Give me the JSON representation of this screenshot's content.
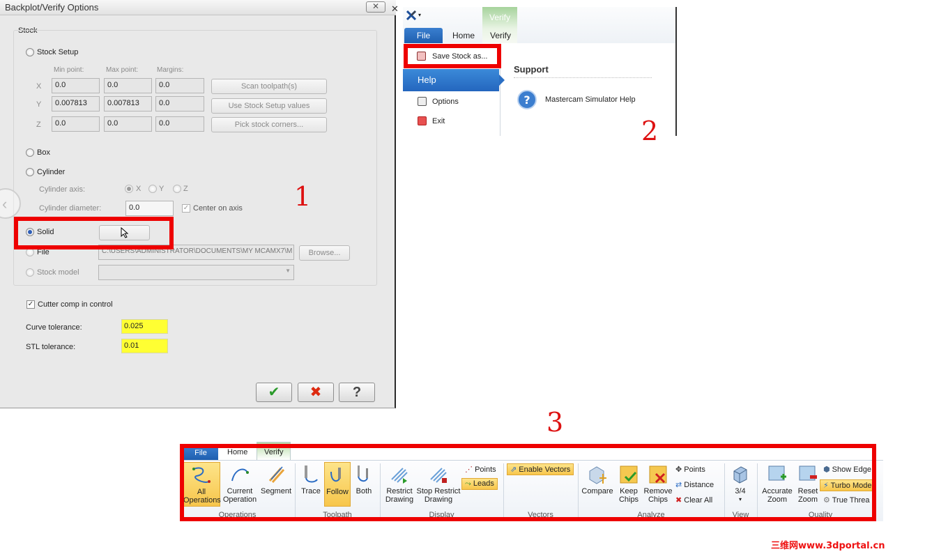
{
  "dialog": {
    "title": "Backplot/Verify Options",
    "close": "✕",
    "stock_group_label": "Stock",
    "stock_setup": {
      "label": "Stock Setup",
      "columns": [
        "Min point:",
        "Max point:",
        "Margins:"
      ],
      "rows": [
        {
          "axis": "X",
          "min": "0.0",
          "max": "0.0",
          "margin": "0.0"
        },
        {
          "axis": "Y",
          "min": "0.007813",
          "max": "0.007813",
          "margin": "0.0"
        },
        {
          "axis": "Z",
          "min": "0.0",
          "max": "0.0",
          "margin": "0.0"
        }
      ],
      "buttons": [
        "Scan toolpath(s)",
        "Use Stock Setup values",
        "Pick stock corners..."
      ]
    },
    "box_label": "Box",
    "cylinder": {
      "label": "Cylinder",
      "axis_label": "Cylinder axis:",
      "axis_options": [
        "X",
        "Y",
        "Z"
      ],
      "diameter_label": "Cylinder diameter:",
      "diameter_value": "0.0",
      "center_on_axis": "Center on axis"
    },
    "solid_label": "Solid",
    "file": {
      "label": "File",
      "path": "C:\\USERS\\ADMINISTRATOR\\DOCUMENTS\\MY MCAMX7\\M",
      "browse": "Browse..."
    },
    "stock_model_label": "Stock model",
    "cutter_comp": "Cutter comp in control",
    "curve_tol_label": "Curve tolerance:",
    "curve_tol_value": "0.025",
    "stl_tol_label": "STL tolerance:",
    "stl_tol_value": "0.01",
    "ok": "✔",
    "cancel": "✖",
    "help": "?"
  },
  "annotations": {
    "n1": "1",
    "n2": "2",
    "n3": "3"
  },
  "file_menu": {
    "qat_icon": "mastercam-x-icon",
    "context_tab": "Verify",
    "tabs": [
      "File",
      "Home",
      "Verify"
    ],
    "items": [
      "Save Stock as...",
      "Help",
      "Options",
      "Exit"
    ],
    "support_heading": "Support",
    "support_item": "Mastercam Simulator Help"
  },
  "ribbon": {
    "tabs": [
      "File",
      "Home",
      "Verify"
    ],
    "groups": {
      "operations": {
        "label": "Operations",
        "buttons": [
          [
            "All",
            "Operations"
          ],
          [
            "Current",
            "Operation"
          ],
          [
            "Segment",
            ""
          ]
        ]
      },
      "toolpath": {
        "label": "Toolpath",
        "buttons": [
          "Trace",
          "Follow",
          "Both"
        ]
      },
      "display": {
        "label": "Display",
        "buttons": [
          [
            "Restrict",
            "Drawing"
          ],
          [
            "Stop Restrict",
            "Drawing"
          ]
        ],
        "small": [
          "Points",
          "Leads"
        ]
      },
      "vectors": {
        "label": "Vectors",
        "small": [
          "Enable Vectors"
        ]
      },
      "analyze": {
        "label": "Analyze",
        "buttons": [
          [
            "Compare",
            ""
          ],
          [
            "Keep",
            "Chips"
          ],
          [
            "Remove",
            "Chips"
          ]
        ],
        "small": [
          "Points",
          "Distance",
          "Clear All"
        ]
      },
      "view": {
        "label": "View",
        "buttons": [
          "3/4"
        ]
      },
      "quality": {
        "label": "Quality",
        "buttons": [
          [
            "Accurate",
            "Zoom"
          ],
          [
            "Reset",
            "Zoom"
          ]
        ],
        "small": [
          "Show Edge",
          "Turbo Mode",
          "True Threa"
        ]
      }
    }
  },
  "watermark": "三维网www.3dportal.cn",
  "colors": {
    "highlight_red": "#ee0000",
    "tolerance_yellow": "#ffff33",
    "file_blue": "#2466be",
    "selected_orange": "#f7c64c"
  }
}
